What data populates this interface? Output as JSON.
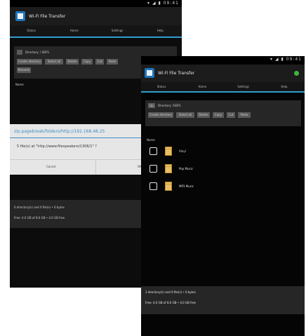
{
  "app": {
    "title": "Wi-Fi File Transfer"
  },
  "tabs": [
    "Status",
    "Home",
    "Settings",
    "Help"
  ],
  "status_icons": "▾ ◢ ▮ 09:41",
  "back_screen": {
    "directory_label": "Directory: / SDFS",
    "actions": [
      "Create directory",
      "Select all",
      "Delete",
      "Copy",
      "Cut",
      "Paste",
      "Rename"
    ],
    "name_header": "Name",
    "dialog": {
      "title": "zip.pagebreak/folders/http://192.168.48.25",
      "body": "5 file(s) at \"http://www.filespeakers/1306/1\" ?",
      "cancel": "Cancel",
      "ok": "OK"
    },
    "footer_line1": "0 directory(s) and 0 file(s) • 0 bytes",
    "footer_line2": "Free: 4.0 GB of 8.0 GB • 4.0 GB free"
  },
  "front_screen": {
    "up_label": "Up",
    "directory_label": "Directory: /SDFS",
    "actions": [
      "Create directory",
      "Select all",
      "Delete",
      "Copy",
      "Cut",
      "Paste"
    ],
    "name_header": "Name",
    "items": [
      "Vinyl",
      "Pop Music",
      "MP3 Music"
    ],
    "footer_line1": "3 directory(s) and 0 file(s) • 0 bytes",
    "footer_line2": "Free: 4.0 GB of 8.0 GB • 4.0 GB free"
  },
  "colors": {
    "accent": "#2f9fd0",
    "status_ok": "#3db83d",
    "folder": "#e8c063"
  }
}
